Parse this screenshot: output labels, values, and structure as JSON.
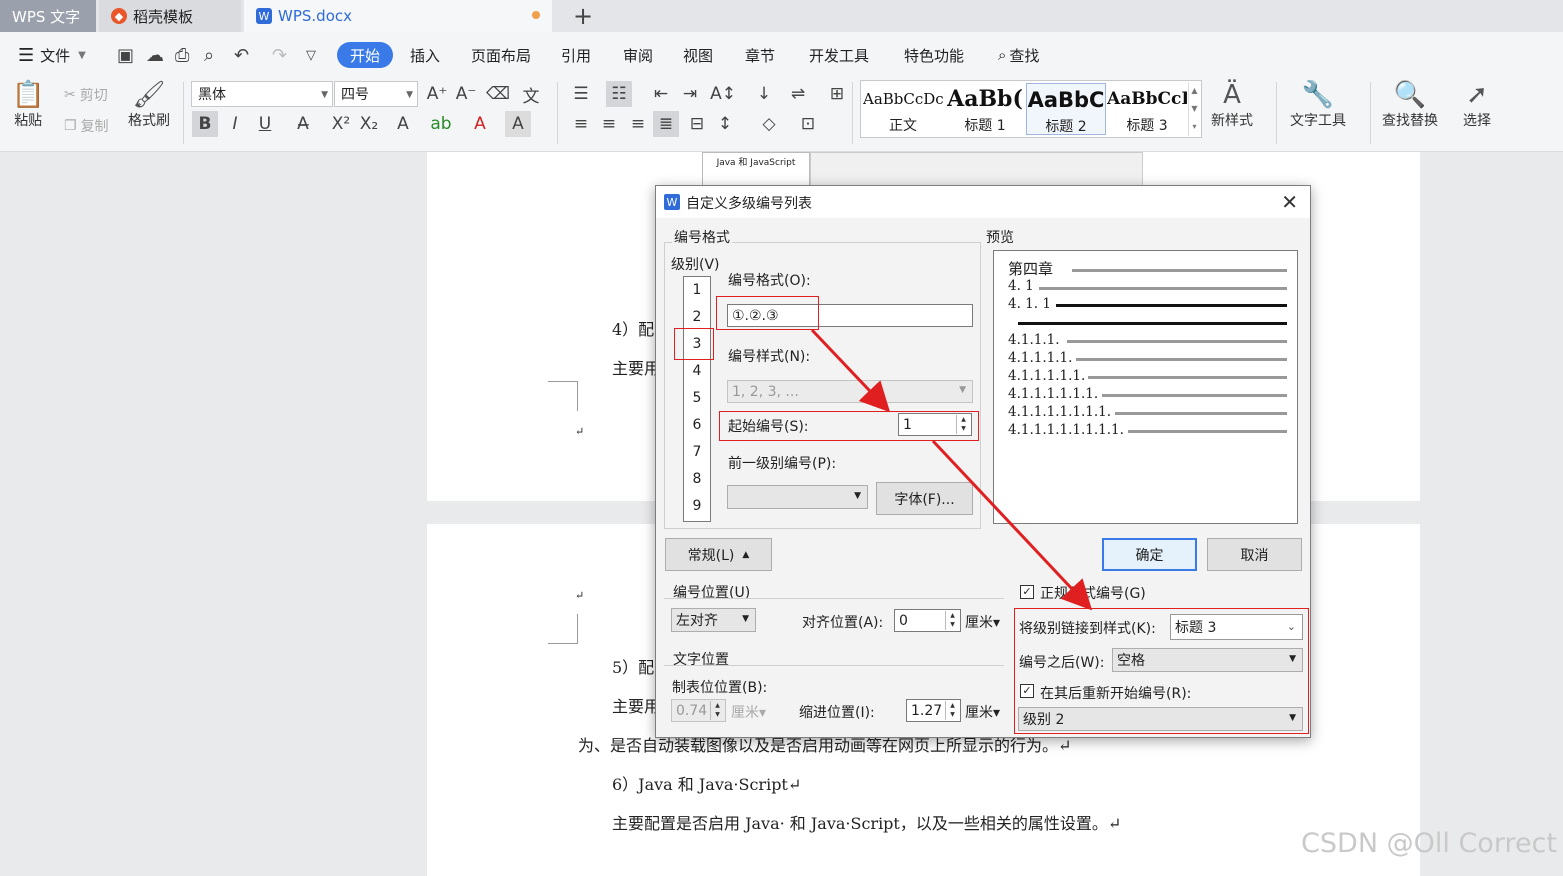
{
  "tabs": {
    "app": "WPS 文字",
    "template": "稻壳模板",
    "doc": "WPS.docx",
    "add": "+"
  },
  "menu": {
    "file": "文件",
    "items": [
      "开始",
      "插入",
      "页面布局",
      "引用",
      "审阅",
      "视图",
      "章节",
      "开发工具",
      "特色功能",
      "查找"
    ]
  },
  "ribbon": {
    "paste": "粘贴",
    "cut": "剪切",
    "copy": "复制",
    "format_painter": "格式刷",
    "font": "黑体",
    "size": "四号",
    "styles": [
      {
        "preview": "AaBbCcDc",
        "label": "正文"
      },
      {
        "preview": "AaBb(",
        "label": "标题 1"
      },
      {
        "preview": "AaBbC",
        "label": "标题 2"
      },
      {
        "preview": "AaBbCcI",
        "label": "标题 3"
      }
    ],
    "new_style": "新样式",
    "text_tools": "文字工具",
    "find_replace": "查找替换",
    "select": "选择"
  },
  "document": {
    "thumb_text": "Java 和 JavaScript",
    "p1_item4": "4）配",
    "p1_main": "主要用",
    "p2_item5": "5）配",
    "p2_main": "主要用",
    "p2_line": "为、是否自动装载图像以及是否启用动画等在网页上所显示的行为。↵",
    "p2_item6": "6）Java 和 Java·Script↵",
    "p2_last": "主要配置是否启用 Java· 和 Java·Script，以及一些相关的属性设置。↵",
    "mark": "↵"
  },
  "dialog": {
    "title": "自定义多级编号列表",
    "group_format": "编号格式",
    "level_label": "级别(V)",
    "levels": [
      "1",
      "2",
      "3",
      "4",
      "5",
      "6",
      "7",
      "8",
      "9"
    ],
    "format_label": "编号格式(O):",
    "format_value": "①.②.③",
    "style_label": "编号样式(N):",
    "style_value": "1, 2, 3, ...",
    "start_label": "起始编号(S):",
    "start_value": "1",
    "prev_level_label": "前一级别编号(P):",
    "font_button": "字体(F)...",
    "preview_label": "预览",
    "preview_lines": [
      "第四章",
      "4. 1",
      "4. 1. 1",
      "4.1.1.1.",
      "4.1.1.1.1.",
      "4.1.1.1.1.1.",
      "4.1.1.1.1.1.1.",
      "4.1.1.1.1.1.1.1.",
      "4.1.1.1.1.1.1.1.1."
    ],
    "general_button": "常规(L)",
    "ok": "确定",
    "cancel": "取消",
    "pos_group": "编号位置(U)",
    "align_value": "左对齐",
    "align_pos_label": "对齐位置(A):",
    "align_pos_value": "0",
    "unit": "厘米",
    "text_pos_group": "文字位置",
    "tab_label": "制表位位置(B):",
    "tab_value": "0.74",
    "indent_label": "缩进位置(I):",
    "indent_value": "1.27",
    "legal_label": "正规形式编号(G)",
    "link_label": "将级别链接到样式(K):",
    "link_value": "标题 3",
    "after_label": "编号之后(W):",
    "after_value": "空格",
    "restart_label": "在其后重新开始编号(R):",
    "restart_value": "级别 2"
  },
  "watermark": "CSDN @Oll Correct",
  "colors": {
    "accent": "#3a7ae8",
    "annotation": "#e02020"
  }
}
